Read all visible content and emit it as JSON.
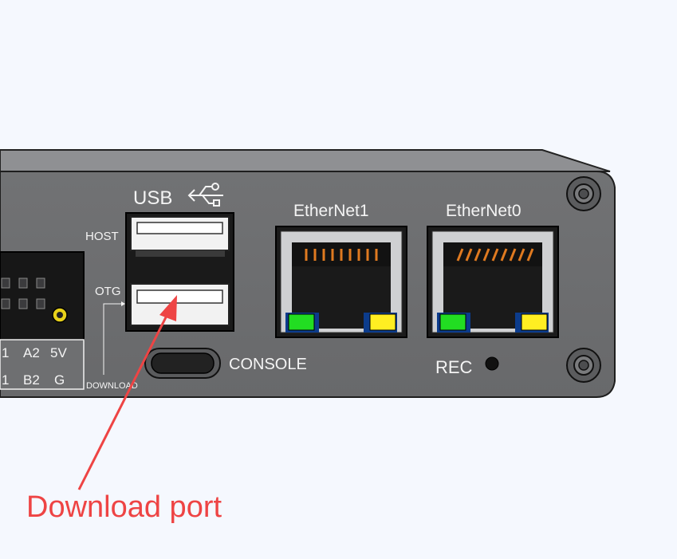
{
  "device": {
    "usb_label": "USB",
    "host_label": "HOST",
    "otg_label": "OTG",
    "download_label": "DOWNLOAD",
    "console_label": "CONSOLE",
    "ethernet1_label": "EtherNet1",
    "ethernet0_label": "EtherNet0",
    "rec_label": "REC",
    "terminal_labels": [
      "1",
      "A2",
      "5V",
      "1",
      "B2",
      "G"
    ]
  },
  "annotation": {
    "text": "Download port",
    "color": "#ee4444"
  },
  "colors": {
    "panel": "#6e6f71",
    "panel_dark": "#3d3d3f",
    "led_green": "#22dd22",
    "led_yellow": "#ffee22",
    "rj45_pins": "#e07a20"
  }
}
